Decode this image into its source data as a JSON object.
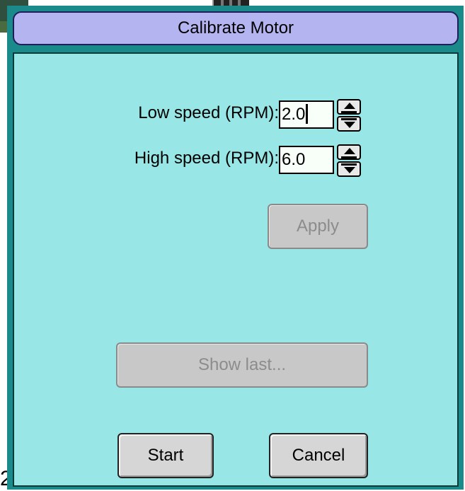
{
  "window": {
    "title": "Calibrate Motor"
  },
  "low_speed": {
    "label": "Low speed (RPM):",
    "value": "2.0"
  },
  "high_speed": {
    "label": "High speed (RPM):",
    "value": "6.0"
  },
  "buttons": {
    "apply": "Apply",
    "show_last": "Show last...",
    "start": "Start",
    "cancel": "Cancel"
  },
  "background": {
    "stray_char": "2"
  },
  "colors": {
    "title_bar": "#b4b4f0",
    "client_bg": "#98e6e6",
    "frame": "#1a8a8a"
  }
}
